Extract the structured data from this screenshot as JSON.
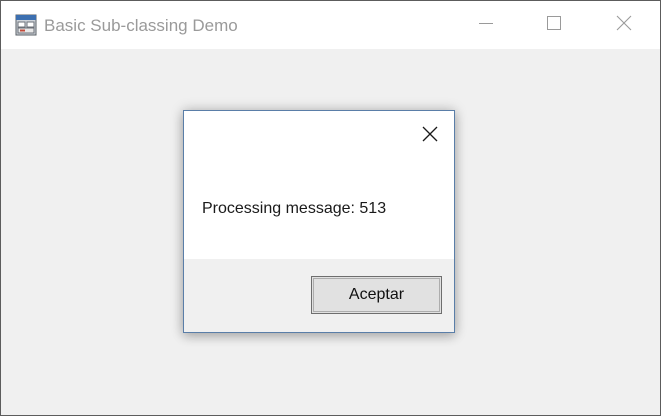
{
  "window": {
    "title": "Basic Sub-classing Demo",
    "icon": "app-window-icon",
    "controls": [
      "minimize-icon",
      "maximize-icon",
      "close-icon"
    ]
  },
  "dialog": {
    "message": "Processing message: 513",
    "ok_label": "Aceptar",
    "close_icon": "close-icon"
  },
  "colors": {
    "client_background": "#f0f0f0",
    "titlebar_background": "#ffffff",
    "title_text": "#9a9a9a",
    "dialog_border": "#5a7ea8",
    "button_face": "#e1e1e1"
  }
}
